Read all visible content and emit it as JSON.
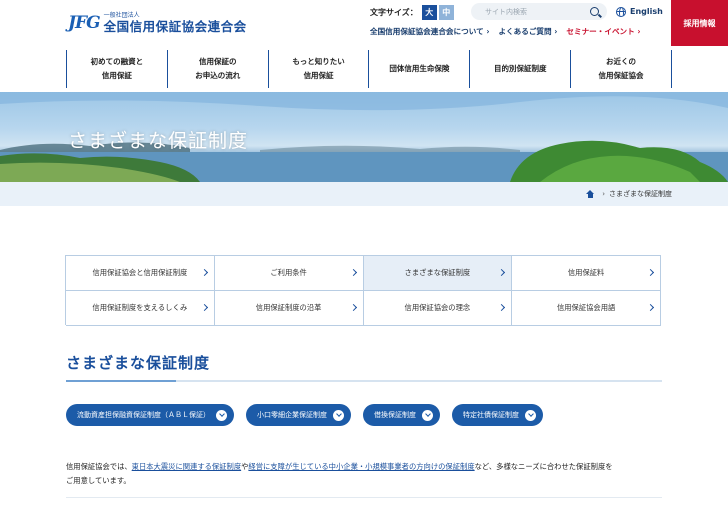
{
  "header": {
    "logo_mark": "JFG",
    "logo_sub": "一般社団法人",
    "logo_main": "全国信用保証協会連合会",
    "font_size_label": "文字サイズ：",
    "font_size_large": "大",
    "font_size_medium": "中",
    "search_placeholder": "サイト内検索",
    "language_label": "English",
    "recruit_label": "採用情報",
    "sublinks": [
      {
        "label": "全国信用保証協会連合会について ›"
      },
      {
        "label": "よくあるご質問 ›"
      },
      {
        "label": "セミナー・イベント ›"
      }
    ]
  },
  "global_nav": [
    {
      "line1": "初めての融資と",
      "line2": "信用保証"
    },
    {
      "line1": "信用保証の",
      "line2": "お申込の流れ"
    },
    {
      "line1": "もっと知りたい",
      "line2": "信用保証"
    },
    {
      "line1": "団体信用生命保険",
      "line2": ""
    },
    {
      "line1": "目的別保証制度",
      "line2": ""
    },
    {
      "line1": "お近くの",
      "line2": "信用保証協会"
    }
  ],
  "hero": {
    "title": "さまざまな保証制度"
  },
  "breadcrumb": {
    "current": "さまざまな保証制度"
  },
  "subnav": [
    {
      "label": "信用保証協会と信用保証制度",
      "active": false
    },
    {
      "label": "ご利用条件",
      "active": false
    },
    {
      "label": "さまざまな保証制度",
      "active": true
    },
    {
      "label": "信用保証料",
      "active": false
    },
    {
      "label": "信用保証制度を支えるしくみ",
      "active": false
    },
    {
      "label": "信用保証制度の沿革",
      "active": false
    },
    {
      "label": "信用保証協会の理念",
      "active": false
    },
    {
      "label": "信用保証協会用語",
      "active": false
    }
  ],
  "section": {
    "title": "さまざまな保証制度",
    "pills": [
      {
        "label": "流動資産担保融資保証制度（ＡＢＬ保証）"
      },
      {
        "label": "小口零細企業保証制度"
      },
      {
        "label": "借換保証制度"
      },
      {
        "label": "特定社債保証制度"
      }
    ],
    "body_prefix": "信用保証協会では、",
    "body_link1": "東日本大震災に関連する保証制度",
    "body_mid": "や",
    "body_link2": "経営に支障が生じている中小企業・小規模事業者の方向けの保証制度",
    "body_suffix": "など、多様なニーズに合わせた保証制度を",
    "body_line2": "ご用意しています。"
  },
  "colors": {
    "brand_blue": "#1a4f9c",
    "accent_red": "#c8102e",
    "pill_blue": "#1c5ba8"
  }
}
